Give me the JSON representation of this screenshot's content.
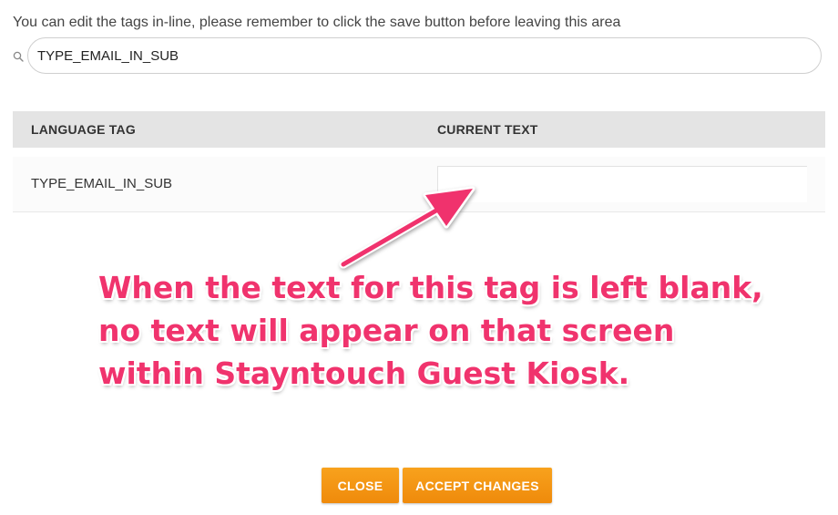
{
  "instruction": "You can edit the tags in-line, please remember to click the save button before leaving this area",
  "search": {
    "value": "TYPE_EMAIL_IN_SUB",
    "icon": "search-icon"
  },
  "table": {
    "headers": [
      "LANGUAGE TAG",
      "CURRENT TEXT"
    ],
    "rows": [
      {
        "tag": "TYPE_EMAIL_IN_SUB",
        "text": ""
      }
    ]
  },
  "annotation": {
    "lines": [
      "When the text for this tag is left blank,",
      "no text will appear on that screen",
      "within Stayntouch Guest Kiosk."
    ],
    "color": "#f0336d"
  },
  "buttons": {
    "close": "CLOSE",
    "accept": "ACCEPT CHANGES",
    "color": "#f39414"
  }
}
